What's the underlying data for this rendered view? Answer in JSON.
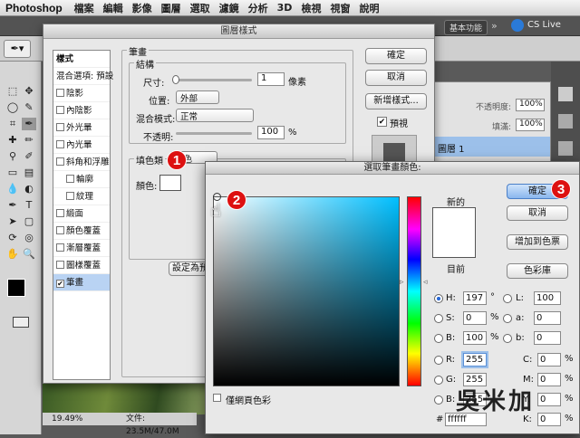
{
  "menubar": {
    "app": "Photoshop",
    "items": [
      "檔案",
      "編輯",
      "影像",
      "圖層",
      "選取",
      "濾鏡",
      "分析",
      "3D",
      "檢視",
      "視窗",
      "說明"
    ]
  },
  "appbar": {
    "workspace": "基本功能",
    "cslive": "CS Live"
  },
  "layers": {
    "opacity_label": "不透明度:",
    "opacity": "100%",
    "fill_label": "填滿:",
    "fill": "100%",
    "layer_name": "圖層 1"
  },
  "status": {
    "zoom": "19.49%",
    "file": "文件: 23.5M/47.0M"
  },
  "layer_style": {
    "title": "圖層樣式",
    "list": [
      {
        "label": "樣式",
        "check": false,
        "active": false
      },
      {
        "label": "混合選項: 預設",
        "check": false,
        "active": false
      },
      {
        "label": "陰影",
        "check": true,
        "checked": false
      },
      {
        "label": "內陰影",
        "check": true,
        "checked": false
      },
      {
        "label": "外光暈",
        "check": true,
        "checked": false
      },
      {
        "label": "內光暈",
        "check": true,
        "checked": false
      },
      {
        "label": "斜角和浮雕",
        "check": true,
        "checked": false
      },
      {
        "label": "輪廓",
        "check": true,
        "checked": false,
        "indent": true
      },
      {
        "label": "紋理",
        "check": true,
        "checked": false,
        "indent": true
      },
      {
        "label": "緞面",
        "check": true,
        "checked": false
      },
      {
        "label": "顏色覆蓋",
        "check": true,
        "checked": false
      },
      {
        "label": "漸層覆蓋",
        "check": true,
        "checked": false
      },
      {
        "label": "圖樣覆蓋",
        "check": true,
        "checked": false
      },
      {
        "label": "筆畫",
        "check": true,
        "checked": true,
        "selected": true
      }
    ],
    "stroke_title": "筆畫",
    "structure_title": "結構",
    "size_label": "尺寸:",
    "size_value": "1",
    "size_unit": "像素",
    "position_label": "位置:",
    "position_value": "外部",
    "blend_label": "混合模式:",
    "blend_value": "正常",
    "opacity_label": "不透明:",
    "opacity_value": "100",
    "opacity_unit": "%",
    "filltype_label": "填色類",
    "filltype_value": "顏色",
    "color_label": "顏色:",
    "default_btn": "設定為預",
    "ok": "確定",
    "cancel": "取消",
    "new_style": "新增樣式...",
    "preview": "預視"
  },
  "picker": {
    "title": "選取筆畫顏色:",
    "new_label": "新的",
    "current_label": "目前",
    "ok": "確定",
    "cancel": "取消",
    "add_swatch": "增加到色票",
    "libraries": "色彩庫",
    "web_only": "僅網頁色彩",
    "H": {
      "label": "H:",
      "value": "197",
      "unit": "°"
    },
    "S": {
      "label": "S:",
      "value": "0",
      "unit": "%"
    },
    "B": {
      "label": "B:",
      "value": "100",
      "unit": "%"
    },
    "R": {
      "label": "R:",
      "value": "255"
    },
    "G": {
      "label": "G:",
      "value": "255"
    },
    "Bb": {
      "label": "B:",
      "value": "255"
    },
    "L": {
      "label": "L:",
      "value": "100"
    },
    "a": {
      "label": "a:",
      "value": "0"
    },
    "b": {
      "label": "b:",
      "value": "0"
    },
    "C": {
      "label": "C:",
      "value": "0",
      "unit": "%"
    },
    "M": {
      "label": "M:",
      "value": "0",
      "unit": "%"
    },
    "Y": {
      "label": "Y:",
      "value": "0",
      "unit": "%"
    },
    "K": {
      "label": "K:",
      "value": "0",
      "unit": "%"
    },
    "hex_label": "#",
    "hex": "ffffff"
  },
  "callouts": [
    "1",
    "2",
    "3"
  ],
  "watermark": "吳米加"
}
